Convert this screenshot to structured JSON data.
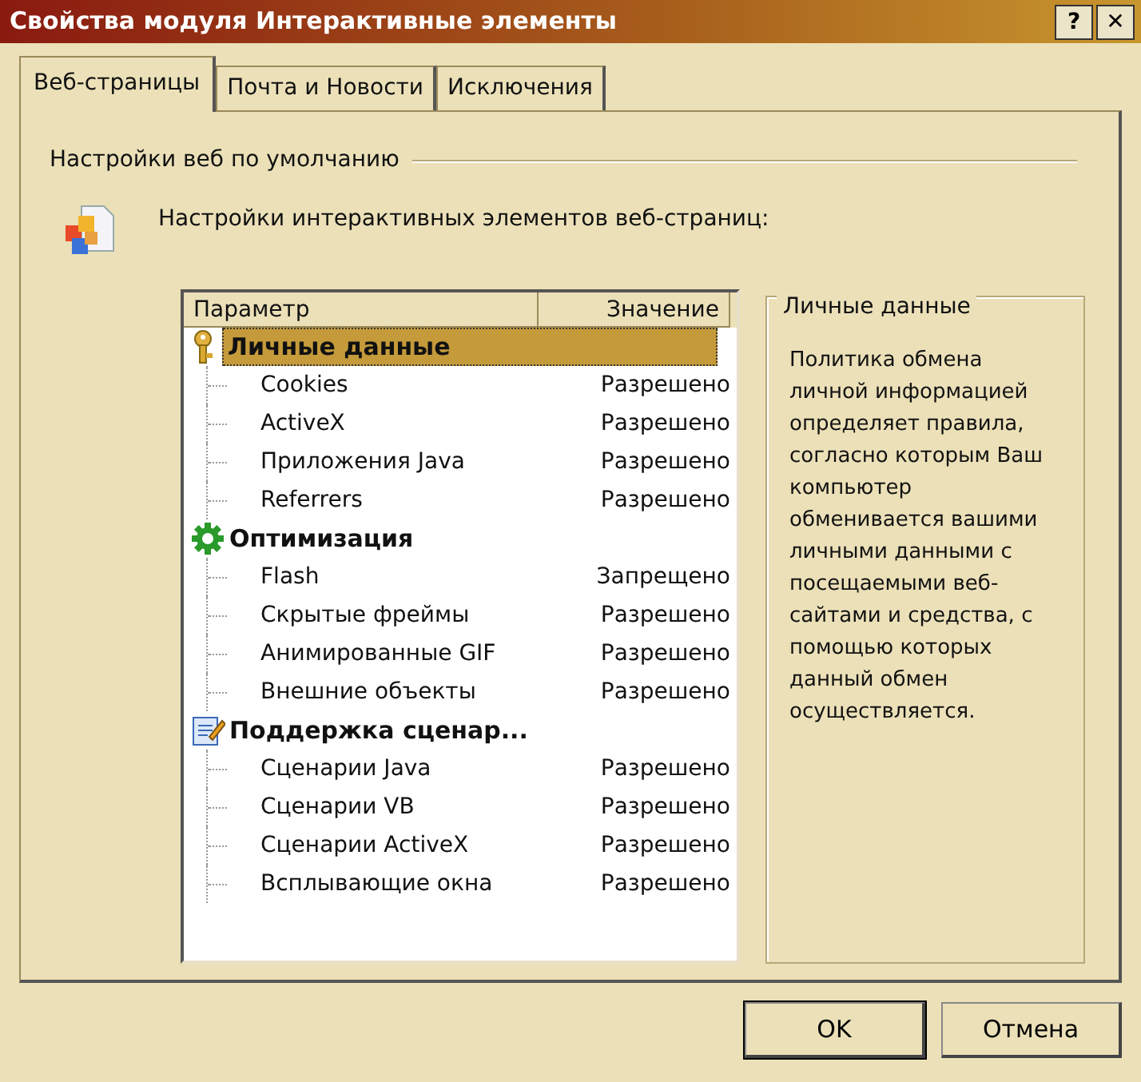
{
  "window": {
    "title": "Свойства модуля Интерактивные элементы",
    "title_buttons": [
      "?",
      "✕"
    ]
  },
  "tabs": [
    {
      "label": "Веб-страницы",
      "selected": true
    },
    {
      "label": "Почта и Новости",
      "selected": false
    },
    {
      "label": "Исключения",
      "selected": false
    }
  ],
  "group_title": "Настройки веб по умолчанию",
  "intro": "Настройки интерактивных элементов веб-страниц:",
  "tree": {
    "columns": [
      "Параметр",
      "Значение"
    ],
    "groups": [
      {
        "kind": "keys",
        "label": "Личные данные",
        "selected": true,
        "children": [
          {
            "name": "Cookies",
            "value": "Разрешено",
            "selected": false
          },
          {
            "name": "ActiveX",
            "value": "Разрешено",
            "selected": false
          },
          {
            "name": "Приложения Java",
            "value": "Разрешено",
            "selected": false
          },
          {
            "name": "Referrers",
            "value": "Разрешено",
            "selected": false
          }
        ]
      },
      {
        "kind": "gear",
        "label": "Оптимизация",
        "selected": false,
        "children": [
          {
            "name": "Flash",
            "value": "Запрещено",
            "selected": false
          },
          {
            "name": "Скрытые фреймы",
            "value": "Разрешено",
            "selected": false
          },
          {
            "name": "Анимированные GIF",
            "value": "Разрешено",
            "selected": false
          },
          {
            "name": "Внешние объекты",
            "value": "Разрешено",
            "selected": false
          }
        ]
      },
      {
        "kind": "script",
        "label": "Поддержка сценар...",
        "selected": false,
        "children": [
          {
            "name": "Сценарии Java",
            "value": "Разрешено",
            "selected": false
          },
          {
            "name": "Сценарии VB",
            "value": "Разрешено",
            "selected": false
          },
          {
            "name": "Сценарии ActiveX",
            "value": "Разрешено",
            "selected": false
          },
          {
            "name": "Всплывающие окна",
            "value": "Разрешено",
            "selected": false
          }
        ]
      }
    ]
  },
  "description": {
    "title": "Личные данные",
    "text": "Политика обмена личной информацией определяет правила, согласно которым Ваш компьютер обменивается вашими личными данными с посещаемыми веб-сайтами и средства, с помощью которых данный обмен осуществляется."
  },
  "buttons": [
    {
      "label": "OK",
      "default": true
    },
    {
      "label": "Отмена",
      "default": false
    }
  ]
}
